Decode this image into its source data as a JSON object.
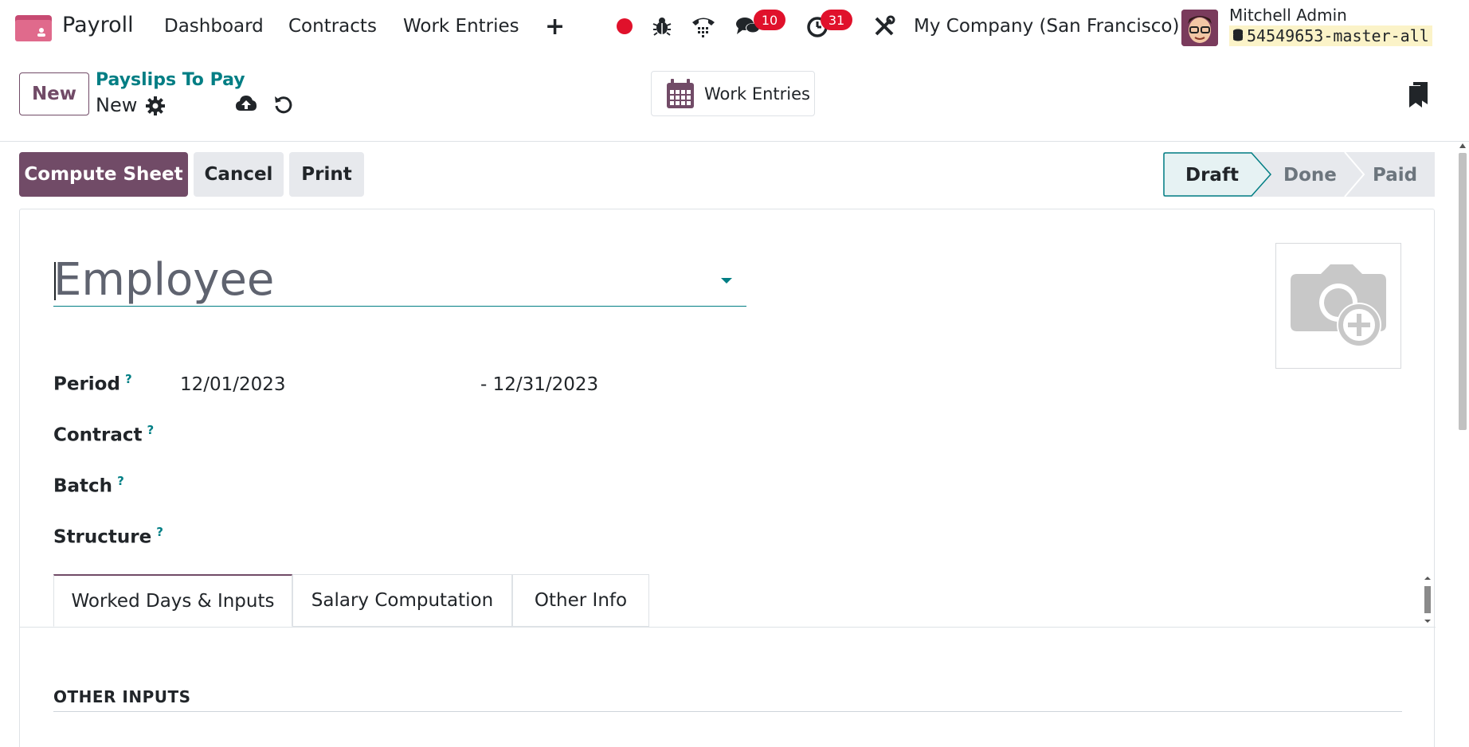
{
  "navbar": {
    "app_name": "Payroll",
    "menu": [
      "Dashboard",
      "Contracts",
      "Work Entries"
    ],
    "messages_count": "10",
    "activities_count": "31",
    "company": "My Company (San Francisco)",
    "user_name": "Mitchell Admin",
    "db_name": "54549653-master-all",
    "colors": {
      "brand": "#714b67",
      "badge": "#e0112b",
      "record": "#e0112b"
    }
  },
  "control": {
    "new_label": "New",
    "breadcrumb_parent": "Payslips To Pay",
    "breadcrumb_current": "New",
    "work_entries_label": "Work Entries"
  },
  "actions": {
    "compute_label": "Compute Sheet",
    "cancel_label": "Cancel",
    "print_label": "Print"
  },
  "status": {
    "stages": [
      "Draft",
      "Done",
      "Paid"
    ],
    "current": "Draft"
  },
  "form": {
    "employee_placeholder": "Employee",
    "period_label": "Period",
    "period_from": "12/01/2023",
    "period_to": "- 12/31/2023",
    "contract_label": "Contract",
    "batch_label": "Batch",
    "structure_label": "Structure",
    "help_mark": "?",
    "tabs": [
      "Worked Days & Inputs",
      "Salary Computation",
      "Other Info"
    ],
    "section_title": "OTHER INPUTS"
  }
}
